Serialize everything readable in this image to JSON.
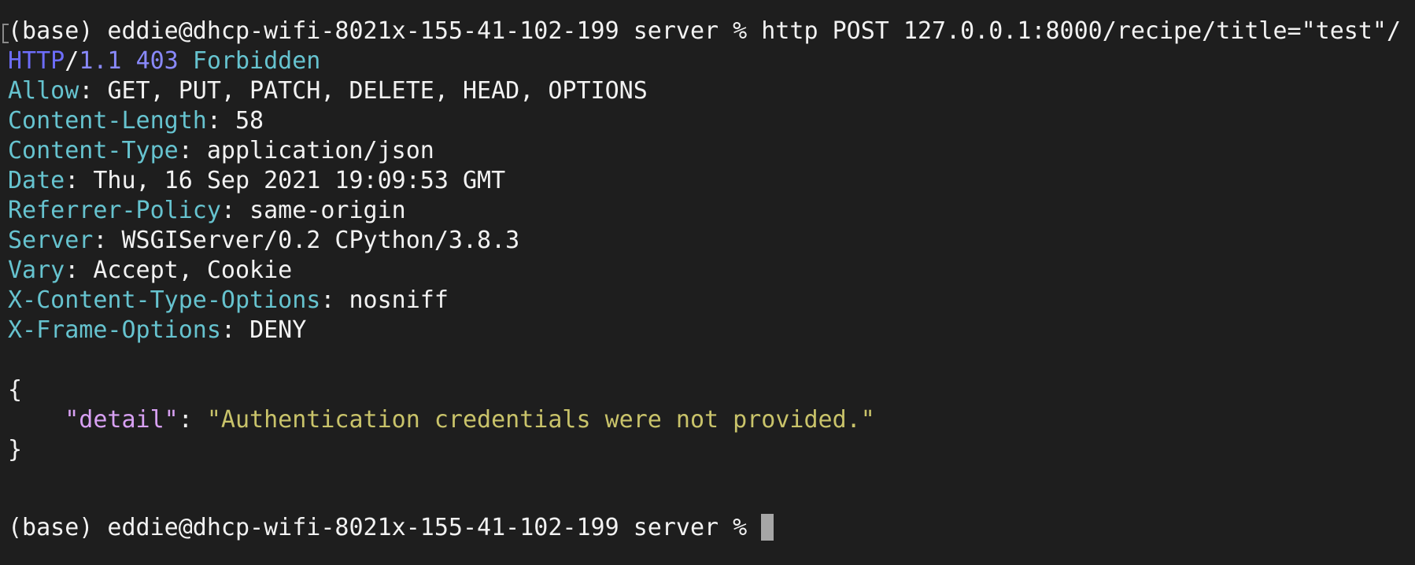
{
  "terminal": {
    "command_prompt": "(base) eddie@dhcp-wifi-8021x-155-41-102-199 server % ",
    "command": "http POST 127.0.0.1:8000/recipe/title=\"test\"/",
    "status": {
      "protocol": "HTTP",
      "slash": "/",
      "version": "1.1",
      "code": "403",
      "reason": "Forbidden"
    },
    "headers": [
      {
        "name": "Allow",
        "value": "GET, PUT, PATCH, DELETE, HEAD, OPTIONS"
      },
      {
        "name": "Content-Length",
        "value": "58"
      },
      {
        "name": "Content-Type",
        "value": "application/json"
      },
      {
        "name": "Date",
        "value": "Thu, 16 Sep 2021 19:09:53 GMT"
      },
      {
        "name": "Referrer-Policy",
        "value": "same-origin"
      },
      {
        "name": "Server",
        "value": "WSGIServer/0.2 CPython/3.8.3"
      },
      {
        "name": "Vary",
        "value": "Accept, Cookie"
      },
      {
        "name": "X-Content-Type-Options",
        "value": "nosniff"
      },
      {
        "name": "X-Frame-Options",
        "value": "DENY"
      }
    ],
    "separator": ": ",
    "body": {
      "open_brace": "{",
      "indent": "    ",
      "key": "\"detail\"",
      "colon": ": ",
      "value": "\"Authentication credentials were not provided.\"",
      "close_brace": "}"
    },
    "final_prompt": "(base) eddie@dhcp-wifi-8021x-155-41-102-199 server % "
  },
  "colors": {
    "background": "#1e1e1e",
    "text": "#f2f2f2",
    "header_name": "#66c3cf",
    "http_keyword": "#6d6dfa",
    "status_code": "#8989fc",
    "json_key": "#d7a0f2",
    "json_string": "#c9c36a",
    "cursor": "#a6a6a6"
  }
}
